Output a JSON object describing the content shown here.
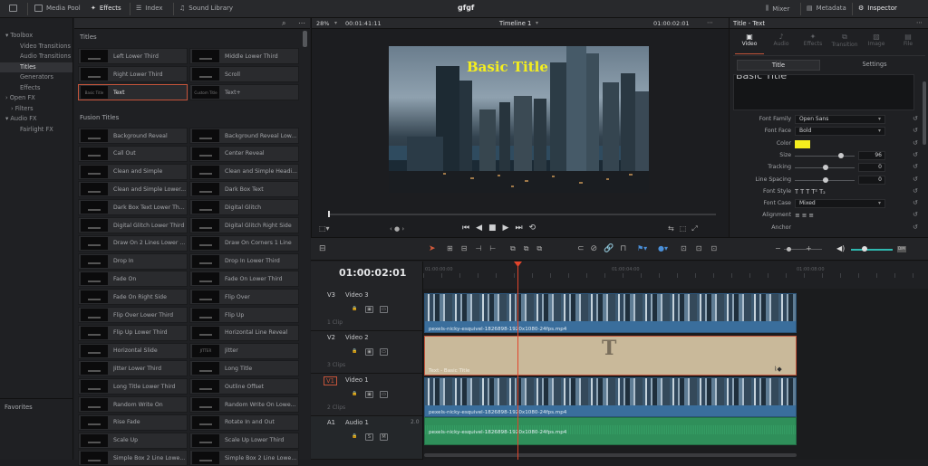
{
  "topbar": {
    "items": [
      "Media Pool",
      "Effects",
      "Index",
      "Sound Library"
    ],
    "project_title": "gfgf",
    "right_items": [
      "Mixer",
      "Metadata",
      "Inspector"
    ]
  },
  "toolbox": {
    "items": [
      {
        "label": "Toolbox",
        "indent": 0,
        "arrow": "v"
      },
      {
        "label": "Video Transitions",
        "indent": 1
      },
      {
        "label": "Audio Transitions",
        "indent": 1
      },
      {
        "label": "Titles",
        "indent": 1,
        "selected": true
      },
      {
        "label": "Generators",
        "indent": 1
      },
      {
        "label": "Effects",
        "indent": 1
      },
      {
        "label": "Open FX",
        "indent": 0,
        "arrow": ">"
      },
      {
        "label": "Filters",
        "indent": 1,
        "arrow": ">"
      },
      {
        "label": "Audio FX",
        "indent": 0,
        "arrow": "v"
      },
      {
        "label": "Fairlight FX",
        "indent": 1
      }
    ],
    "favorites": "Favorites"
  },
  "titles_panel": {
    "section1": "Titles",
    "titles": [
      {
        "left": "Left Lower Third",
        "right": "Middle Lower Third"
      },
      {
        "left": "Right Lower Third",
        "right": "Scroll"
      },
      {
        "left": "Text",
        "right": "Text+",
        "left_thumb": "Basic Title",
        "right_thumb": "Custom Title"
      }
    ],
    "section2": "Fusion Titles",
    "fusion": [
      {
        "left": "Background Reveal",
        "right": "Background Reveal Low..."
      },
      {
        "left": "Call Out",
        "right": "Center Reveal"
      },
      {
        "left": "Clean and Simple",
        "right": "Clean and Simple Headi..."
      },
      {
        "left": "Clean and Simple Lower...",
        "right": "Dark Box Text"
      },
      {
        "left": "Dark Box Text Lower Th...",
        "right": "Digital Glitch"
      },
      {
        "left": "Digital Glitch Lower Third",
        "right": "Digital Glitch Right Side"
      },
      {
        "left": "Draw On 2 Lines Lower ...",
        "right": "Draw On Corners 1 Line"
      },
      {
        "left": "Drop In",
        "right": "Drop In Lower Third"
      },
      {
        "left": "Fade On",
        "right": "Fade On Lower Third"
      },
      {
        "left": "Fade On Right Side",
        "right": "Flip Over"
      },
      {
        "left": "Flip Over Lower Third",
        "right": "Flip Up"
      },
      {
        "left": "Flip Up Lower Third",
        "right": "Horizontal Line Reveal"
      },
      {
        "left": "Horizontal Slide",
        "right": "Jitter",
        "right_thumb": "JITTER"
      },
      {
        "left": "Jitter Lower Third",
        "right": "Long Title"
      },
      {
        "left": "Long Title Lower Third",
        "right": "Outline Offset"
      },
      {
        "left": "Random Write On",
        "right": "Random Write On Lowe..."
      },
      {
        "left": "Rise Fade",
        "right": "Rotate In and Out"
      },
      {
        "left": "Scale Up",
        "right": "Scale Up Lower Third"
      },
      {
        "left": "Simple Box 2 Line Lowe...",
        "right": "Simple Box 2 Line Lowe..."
      }
    ]
  },
  "viewer": {
    "zoom": "28%",
    "source_tc": "00:01:41:11",
    "timeline_name": "Timeline 1",
    "record_tc": "01:00:02:01",
    "overlay_title": "Basic Title"
  },
  "inspector": {
    "header": "Title - Text",
    "tabs": [
      "Video",
      "Audio",
      "Effects",
      "Transition",
      "Image",
      "File"
    ],
    "subtabs": [
      "Title",
      "Settings"
    ],
    "text_preview": "Basic Title",
    "props": [
      {
        "label": "Font Family",
        "value": "Open Sans",
        "kind": "dropdown"
      },
      {
        "label": "Font Face",
        "value": "Bold",
        "kind": "dropdown"
      },
      {
        "label": "Color",
        "value": "#f4ee1e",
        "kind": "color"
      },
      {
        "label": "Size",
        "value": "96",
        "kind": "slider",
        "fill": 0.75
      },
      {
        "label": "Tracking",
        "value": "0",
        "kind": "slider",
        "fill": 0.5
      },
      {
        "label": "Line Spacing",
        "value": "0",
        "kind": "slider",
        "fill": 0.5
      },
      {
        "label": "Font Style",
        "value": "T  T  T  T²  T₂",
        "kind": "icons"
      },
      {
        "label": "Font Case",
        "value": "Mixed",
        "kind": "dropdown"
      },
      {
        "label": "Alignment",
        "value": "≡  ≡  ≡",
        "kind": "icons"
      },
      {
        "label": "Anchor",
        "value": "",
        "kind": "icons"
      }
    ]
  },
  "timeline": {
    "timecode": "01:00:02:01",
    "ruler": [
      "01:00:00:00",
      "01:00:04:00",
      "01:00:08:00"
    ],
    "tracks": [
      {
        "id": "V3",
        "name": "Video 3",
        "clips": "1 Clip",
        "clip_label": "pexels-nicky-esquivel-1826898-1920x1080-24fps.mp4"
      },
      {
        "id": "V2",
        "name": "Video 2",
        "clips": "3 Clips",
        "clip_label": "Text - Basic Title"
      },
      {
        "id": "V1",
        "name": "Video 1",
        "clips": "2 Clips",
        "clip_label": "pexels-nicky-esquivel-1826898-1920x1080-24fps.mp4"
      },
      {
        "id": "A1",
        "name": "Audio 1",
        "clips": "",
        "level": "2.0",
        "clip_label": "pexels-nicky-esquivel-1826898-1920x1080-24fps.mp4"
      }
    ]
  },
  "colors": {
    "accent": "#c4543a",
    "audio": "#2f8f5a",
    "video": "#3a6e9c",
    "title_clip": "#c9b99a"
  }
}
